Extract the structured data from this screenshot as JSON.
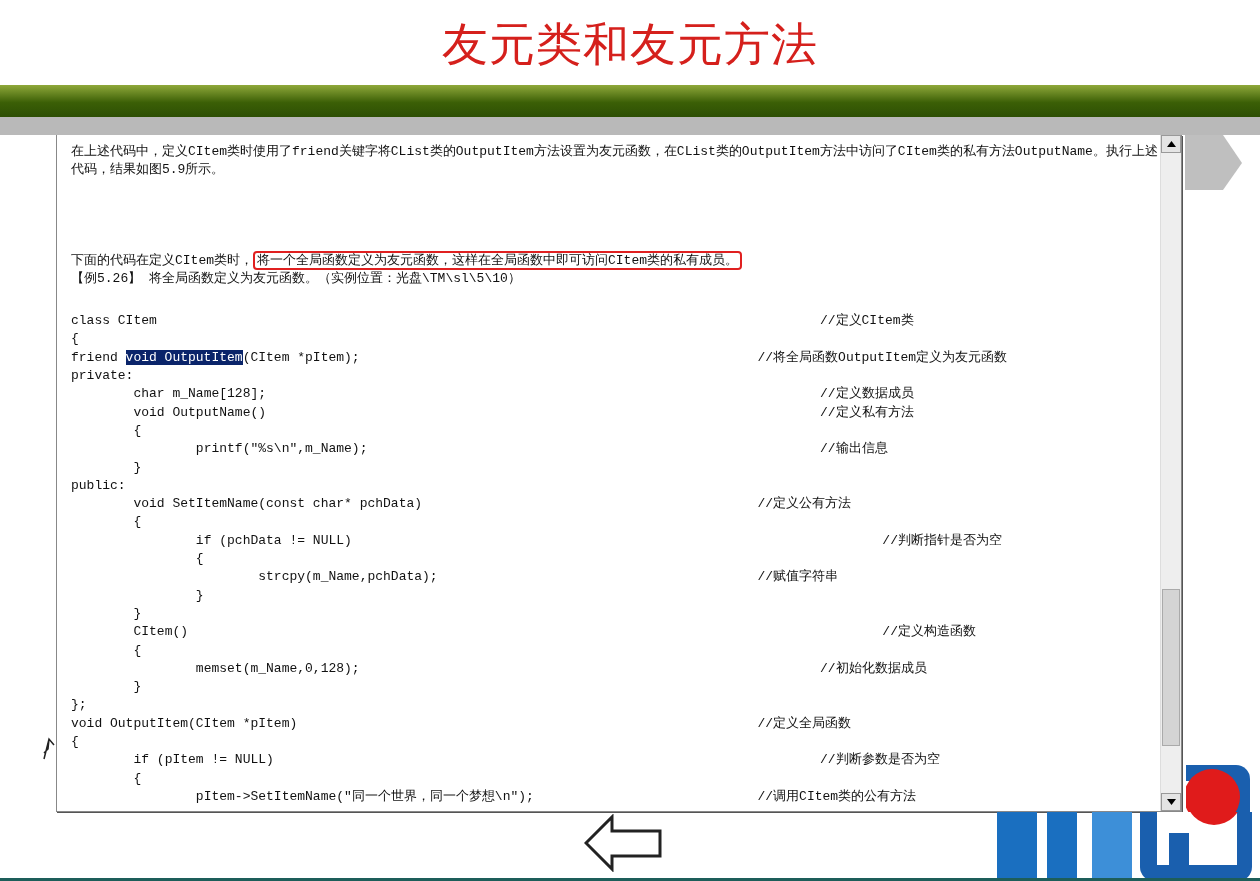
{
  "slide": {
    "title": "友元类和友元方法"
  },
  "text_box": {
    "paragraphs": [
      {
        "text": "在上述代码中，定义CItem类时使用了friend关键字将CList类的OutputItem方法设置为友元函数，在CList类的OutputItem方法中访问了CItem类的私有方法OutputName。执行上述代码，结果如图5.9所示。"
      },
      {
        "text": "下面的代码在定义CItem类时，",
        "boxed": "将一个全局函数定义为友元函数，这样在全局函数中即可访问CItem类的私有成员。"
      },
      {
        "text": "【例5.26】 将全局函数定义为友元函数。（实例位置：光盘\\TM\\sl\\5\\10）"
      }
    ],
    "code_lines": [
      {
        "code": "class CItem\t\t\t\t\t\t\t\t\t\t\t//定义CItem类"
      },
      {
        "code": "{"
      },
      {
        "code": "friend ",
        "selection": "void OutputItem",
        "code_after": "(CItem *pItem);\t\t\t\t\t\t\t//将全局函数OutputItem定义为友元函数"
      },
      {
        "code": "private:"
      },
      {
        "code": "\tchar m_Name[128];\t\t\t\t\t\t\t\t\t//定义数据成员"
      },
      {
        "code": "\tvoid OutputName()\t\t\t\t\t\t\t\t\t//定义私有方法"
      },
      {
        "code": "\t{"
      },
      {
        "code": "\t\tprintf(″%s\\n″,m_Name);\t\t\t\t\t\t\t\t//输出信息"
      },
      {
        "code": "\t}"
      },
      {
        "code": "public:"
      },
      {
        "code": "\tvoid SetItemName(const char* pchData)\t\t\t\t\t\t//定义公有方法"
      },
      {
        "code": "\t{"
      },
      {
        "code": "\t\tif (pchData != NULL)\t\t\t\t\t\t\t\t\t//判断指针是否为空"
      },
      {
        "code": "\t\t{"
      },
      {
        "code": "\t\t\tstrcpy(m_Name,pchData);\t\t\t\t\t\t//赋值字符串"
      },
      {
        "code": "\t\t}"
      },
      {
        "code": "\t}"
      },
      {
        "code": "\tCItem()\t\t\t\t\t\t\t\t\t\t\t\t//定义构造函数"
      },
      {
        "code": "\t{"
      },
      {
        "code": "\t\tmemset(m_Name,0,128);\t\t\t\t\t\t\t\t//初始化数据成员"
      },
      {
        "code": "\t}"
      },
      {
        "code": "};"
      },
      {
        "code": "void OutputItem(CItem *pItem)\t\t\t\t\t\t\t\t//定义全局函数"
      },
      {
        "code": "{"
      },
      {
        "code": "\tif (pItem != NULL)\t\t\t\t\t\t\t\t\t//判断参数是否为空"
      },
      {
        "code": "\t{"
      },
      {
        "code": "\t\tpItem->SetItemName(″同一个世界，同一个梦想\\n″);\t\t\t\t//调用CItem类的公有方法"
      }
    ]
  }
}
